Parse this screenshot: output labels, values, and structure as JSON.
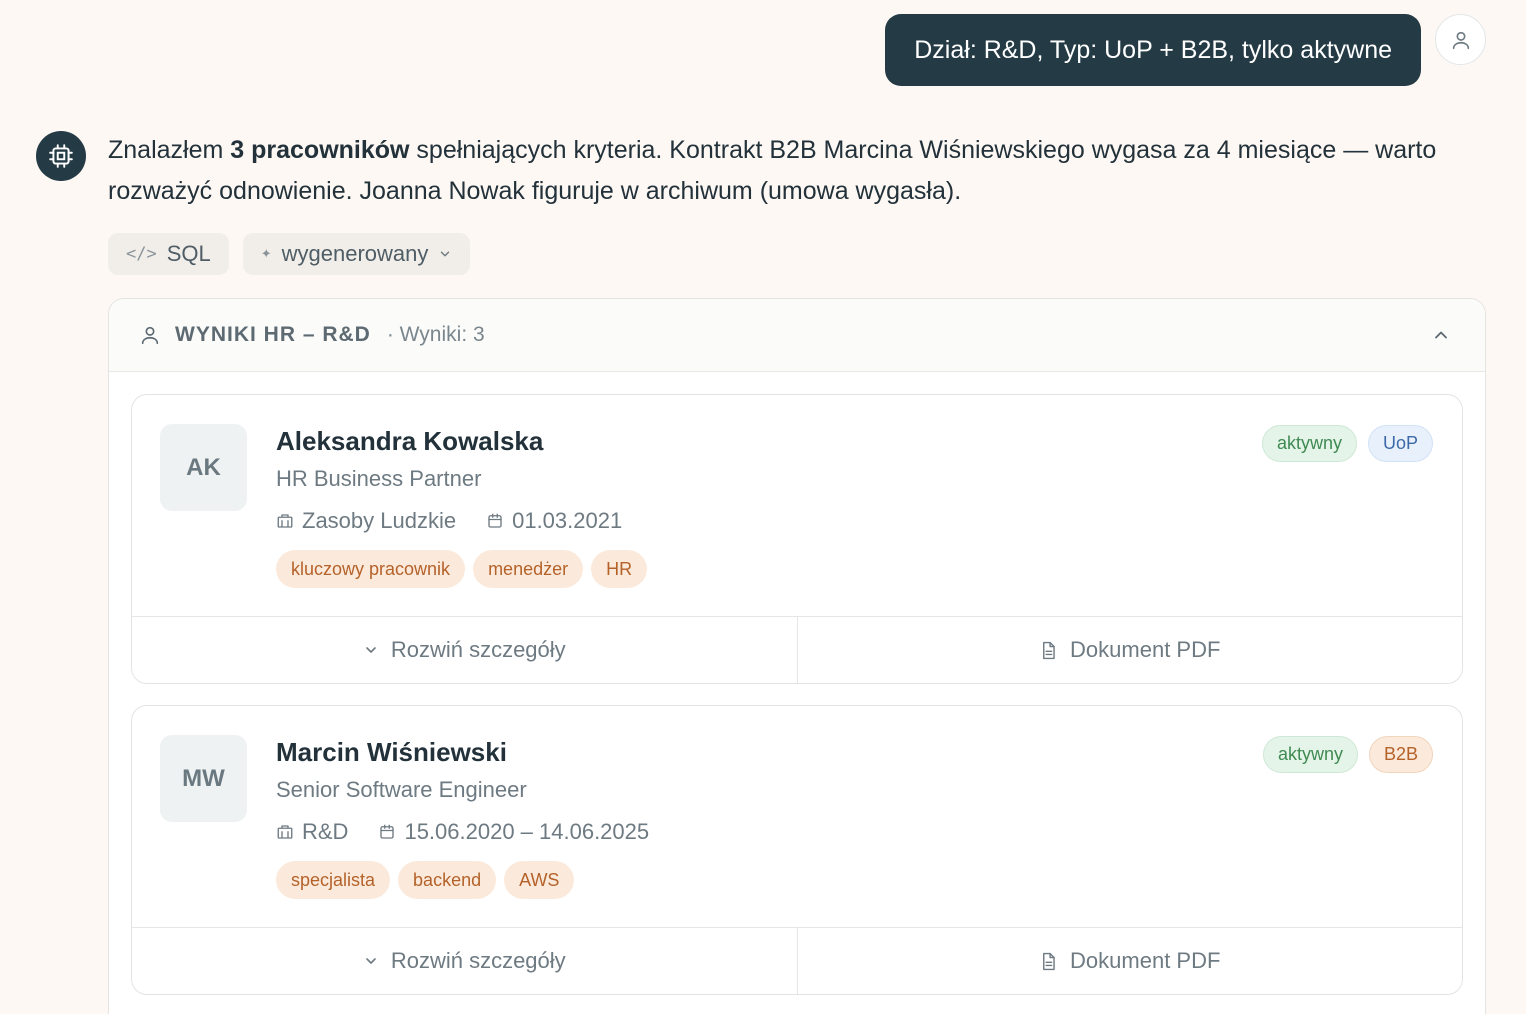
{
  "user_message": "Dział: R&D, Typ: UoP + B2B, tylko aktywne",
  "assistant": {
    "text_before": "Znalazłem ",
    "text_bold": "3 pracowników",
    "text_after": " spełniających kryteria. Kontrakt B2B Marcina Wiśniewskiego wygasa za 4 miesiące — warto rozważyć odnowienie. Joanna Nowak figuruje w archiwum (umowa wygasła).",
    "chips": [
      {
        "symbol": "</>",
        "label": "SQL"
      },
      {
        "symbol": "✦",
        "label": "wygenerowany"
      }
    ]
  },
  "results": {
    "title": "WYNIKI HR – R&D",
    "count_label": "· Wyniki: 3",
    "cards": [
      {
        "initials": "AK",
        "name": "Aleksandra Kowalska",
        "role": "HR Business Partner",
        "department": "Zasoby Ludzkie",
        "date": "01.03.2021",
        "tags": [
          "kluczowy pracownik",
          "menedżer",
          "HR"
        ],
        "status": "aktywny",
        "contract": "UoP",
        "expand_label": "Rozwiń szczegóły",
        "pdf_label": "Dokument PDF"
      },
      {
        "initials": "MW",
        "name": "Marcin Wiśniewski",
        "role": "Senior Software Engineer",
        "department": "R&D",
        "date": "15.06.2020 – 14.06.2025",
        "tags": [
          "specjalista",
          "backend",
          "AWS"
        ],
        "status": "aktywny",
        "contract": "B2B",
        "expand_label": "Rozwiń szczegóły",
        "pdf_label": "Dokument PDF"
      }
    ]
  }
}
